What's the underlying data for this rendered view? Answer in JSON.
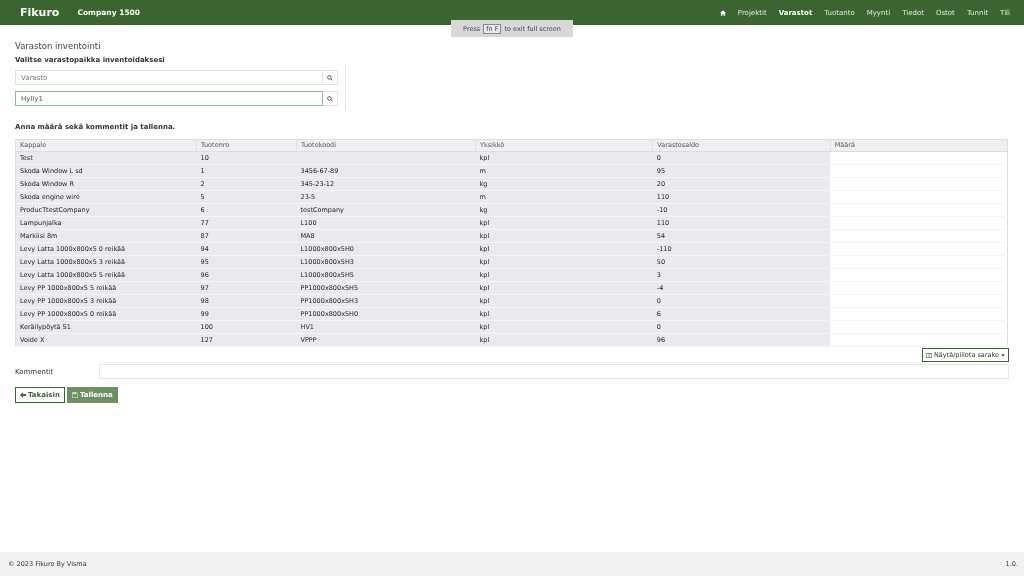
{
  "navbar": {
    "logo": "Fikuro",
    "company": "Company 1500",
    "items": [
      {
        "label": "Projektit",
        "selected": false
      },
      {
        "label": "Varastot",
        "selected": true
      },
      {
        "label": "Tuotanto",
        "selected": false
      },
      {
        "label": "Myynti",
        "selected": false
      },
      {
        "label": "Tiedot",
        "selected": false
      },
      {
        "label": "Ostot",
        "selected": false
      },
      {
        "label": "Tunnit",
        "selected": false
      },
      {
        "label": "Tili",
        "selected": false
      }
    ]
  },
  "fullscreen_toast": {
    "before": "Press",
    "key": "fn F",
    "after": "to exit full screen"
  },
  "title": "Varaston inventointi",
  "subtitle": "Valitse varastopaikka inventoidaksesi",
  "fields": [
    {
      "placeholder": "Varasto",
      "focused": false
    },
    {
      "value": "Hylly1",
      "focused": true
    }
  ],
  "instruction": "Anna määrä sekä kommentit ja tallenna.",
  "table": {
    "columns": [
      "Kappale",
      "Tuotenro",
      "Tuotekoodi",
      "Yksikkö",
      "Varastosaldo",
      "Määrä"
    ],
    "rows": [
      [
        "Test",
        "10",
        "",
        "kpl",
        "0"
      ],
      [
        "Skoda Window L sd",
        "1",
        "3456-67-89",
        "m",
        "95"
      ],
      [
        "Skoda Window R",
        "2",
        "345-23-12",
        "kg",
        "20"
      ],
      [
        "Skoda engine wire",
        "5",
        "23-5",
        "m",
        "110"
      ],
      [
        "ProducTtestCompany",
        "6",
        "testCompany",
        "kg",
        "-10"
      ],
      [
        "Lampunjalka",
        "77",
        "L100",
        "kpl",
        "110"
      ],
      [
        "Markiisi 8m",
        "87",
        "MA8",
        "kpl",
        "54"
      ],
      [
        "Levy Latta 1000x800x5 0 reikää",
        "94",
        "L1000x800x5H0",
        "kpl",
        "-110"
      ],
      [
        "Levy Latta 1000x800x5 3 reikää",
        "95",
        "L1000x800x5H3",
        "kpl",
        "50"
      ],
      [
        "Levy Latta 1000x800x5 5 reikää",
        "96",
        "L1000x800x5H5",
        "kpl",
        "3"
      ],
      [
        "Levy PP 1000x800x5 5 reikää",
        "97",
        "PP1000x800x5H5",
        "kpl",
        "-4"
      ],
      [
        "Levy PP 1000x800x5 3 reikää",
        "98",
        "PP1000x800x5H3",
        "kpl",
        "0"
      ],
      [
        "Levy PP 1000x800x5 0 reikää",
        "99",
        "PP1000x800x5H0",
        "kpl",
        "6"
      ],
      [
        "Keräilypöytä S1",
        "100",
        "HV1",
        "kpl",
        "0"
      ],
      [
        "Voide X",
        "127",
        "VPPP",
        "kpl",
        "96"
      ]
    ]
  },
  "column_toggle": "Näytä/piilota sarake",
  "comment_label": "Kommentit",
  "buttons": [
    {
      "label": "Takaisin",
      "kind": "back"
    },
    {
      "label": "Tallenna",
      "kind": "save"
    }
  ],
  "footer": {
    "copyright": "© 2023 Fikuro By Visma",
    "version": "1.0."
  }
}
